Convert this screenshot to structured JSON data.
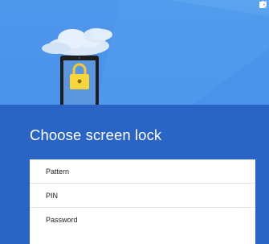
{
  "screen": {
    "title": "Choose screen lock"
  },
  "options": [
    {
      "label": "Pattern"
    },
    {
      "label": "PIN"
    },
    {
      "label": "Password"
    }
  ],
  "status_bar": {
    "icons": [
      "minus-circle-icon",
      "signal-icon",
      "battery-icon"
    ]
  },
  "illustration": {
    "icons": [
      "cloud-icon",
      "phone-lock-icon",
      "padlock-icon"
    ]
  },
  "colors": {
    "hero_blue": "#4f98ec",
    "background_blue": "#2a65c6",
    "lock_yellow": "#f7d53c",
    "card": "#ffffff"
  }
}
